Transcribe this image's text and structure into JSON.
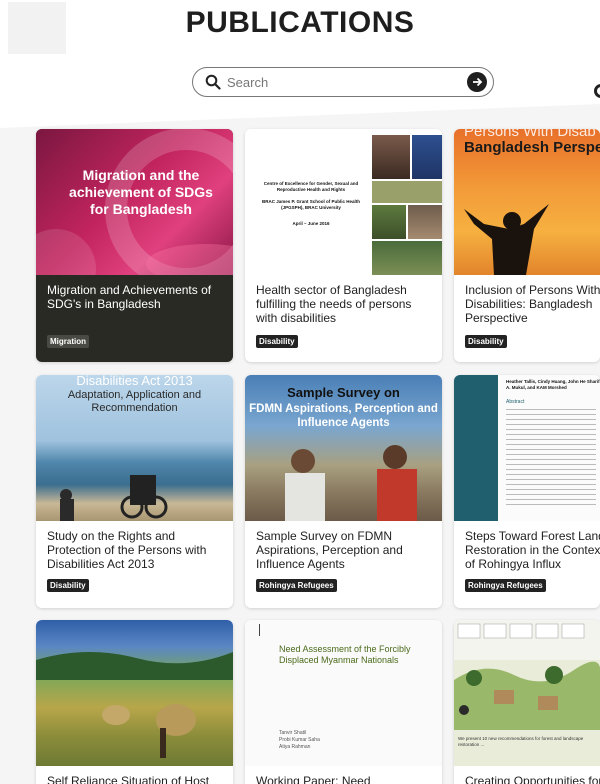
{
  "page": {
    "title": "PUBLICATIONS"
  },
  "search": {
    "placeholder": "Search"
  },
  "cards": [
    {
      "title": "Migration and Achievements of SDG's in Bangladesh",
      "tag": "Migration",
      "cover_text": "Migration and the achievement of SDGs for Bangladesh"
    },
    {
      "title": "Health sector of Bangladesh fulfilling the needs of persons with disabilities",
      "tag": "Disability",
      "cover_lines": [
        "Centre of Excellence for Gender, Sexual and Reproductive Health and Rights",
        "BRAC James P. Grant School of Public Health (JPGSPH), BRAC University",
        "April – June 2016"
      ]
    },
    {
      "title": "Inclusion of Persons With Disabilities: Bangladesh Perspective",
      "tag": "Disability",
      "cover_line1": "Persons With Disab",
      "cover_line2": "Bangladesh Perspe"
    },
    {
      "title": "Study on the Rights and Protection of the Persons with Disabilities Act 2013",
      "tag": "Disability",
      "cover_line1": "Disabilities Act 2013",
      "cover_line2": "Adaptation, Application and Recommendation"
    },
    {
      "title": "Sample Survey on FDMN Aspirations, Perception and Influence Agents",
      "tag": "Rohingya Refugees",
      "cover_line1": "Sample Survey on",
      "cover_line2": "FDMN Aspirations, Perception and Influence Agents"
    },
    {
      "title": "Steps Toward Forest Land Restoration in the Context of Rohingya Influx",
      "tag": "Rohingya Refugees",
      "cover_authors": "Heather Tallis, Cindy Huang, John He Sharif A. Mukul, and KAM Morshed",
      "cover_abstract": "Abstract"
    },
    {
      "title": "Self Reliance Situation of Host",
      "tag": ""
    },
    {
      "title": "Working Paper: Need",
      "tag": "",
      "cover_title": "Need Assessment of the Forcibly Displaced Myanmar Nationals",
      "cover_authors": "Tanvir Shatil\nProbi Kumar Saha\nAtiya Rahman"
    },
    {
      "title": "Creating Opportunities for",
      "tag": "",
      "cover_caption": "We present 10 new recommendations for forest and landscape restoration ..."
    }
  ]
}
